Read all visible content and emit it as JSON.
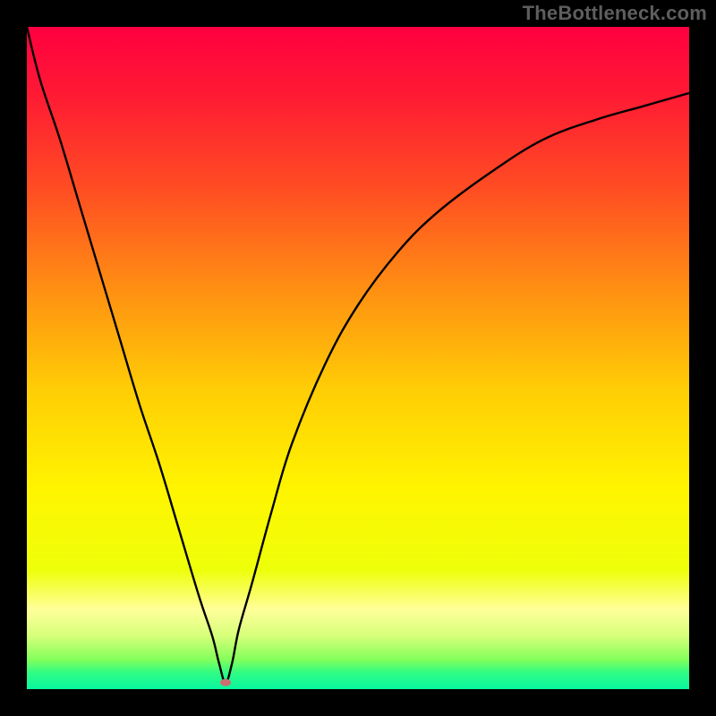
{
  "watermark": "TheBottleneck.com",
  "chart_data": {
    "type": "line",
    "title": "",
    "xlabel": "",
    "ylabel": "",
    "xlim": [
      0,
      100
    ],
    "ylim": [
      0,
      100
    ],
    "grid": false,
    "legend": false,
    "annotations": [],
    "dip_marker": {
      "x": 30,
      "y": 1,
      "color": "#cd6e71"
    },
    "gradient_stops": [
      {
        "offset": 0.0,
        "color": "#ff0040"
      },
      {
        "offset": 0.1,
        "color": "#ff1934"
      },
      {
        "offset": 0.25,
        "color": "#ff4f22"
      },
      {
        "offset": 0.4,
        "color": "#ff9112"
      },
      {
        "offset": 0.55,
        "color": "#ffce05"
      },
      {
        "offset": 0.7,
        "color": "#fff500"
      },
      {
        "offset": 0.82,
        "color": "#eeff0a"
      },
      {
        "offset": 0.88,
        "color": "#ffff9a"
      },
      {
        "offset": 0.92,
        "color": "#d6ff7a"
      },
      {
        "offset": 0.955,
        "color": "#84ff5a"
      },
      {
        "offset": 0.975,
        "color": "#30fc84"
      },
      {
        "offset": 1.0,
        "color": "#08f7a0"
      }
    ],
    "series": [
      {
        "name": "curve",
        "x": [
          0,
          2,
          5,
          8,
          11,
          14,
          17,
          20,
          23,
          26,
          28,
          29,
          30,
          31,
          32,
          34,
          37,
          40,
          45,
          50,
          56,
          62,
          70,
          78,
          86,
          93,
          100
        ],
        "y": [
          100,
          92,
          83,
          73,
          63,
          53,
          43,
          34,
          24,
          14,
          8,
          4,
          1,
          4,
          9,
          16,
          27,
          37,
          49,
          58,
          66,
          72,
          78,
          83,
          86,
          88,
          90
        ]
      }
    ]
  }
}
